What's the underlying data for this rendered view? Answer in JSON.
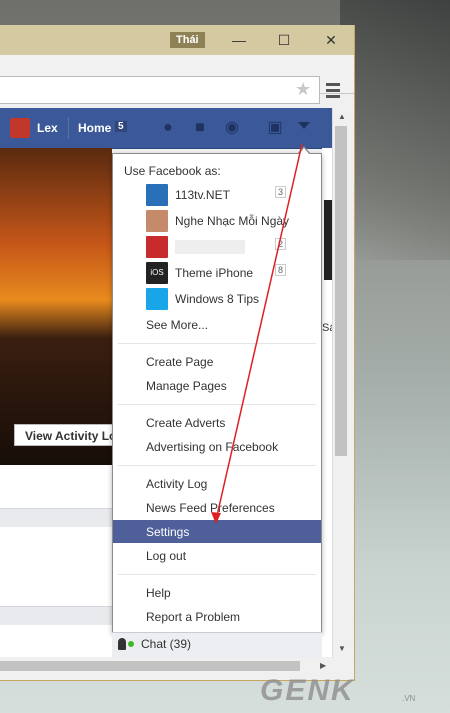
{
  "window": {
    "user_label": "Thái",
    "minimize": "—",
    "maximize": "☐",
    "close": "✕"
  },
  "fbbar": {
    "user_name": "Lex",
    "home_label": "Home",
    "home_count": "5"
  },
  "cover": {
    "view_activity_label": "View Activity Lo"
  },
  "dropdown": {
    "header": "Use Facebook as:",
    "pages": [
      {
        "name": "113tv.NET",
        "count": "3",
        "color": "#2a70b8"
      },
      {
        "name": "Nghe Nhạc Mỗi Ngày",
        "count": "",
        "color": "#c48a6a"
      },
      {
        "name": "",
        "count": "2",
        "color": "#c72b2b"
      },
      {
        "name": "Theme iPhone",
        "count": "8",
        "color": "#222222"
      },
      {
        "name": "Windows 8 Tips",
        "count": "",
        "color": "#19a6e8"
      }
    ],
    "see_more": "See More...",
    "create_page": "Create Page",
    "manage_pages": "Manage Pages",
    "create_adverts": "Create Adverts",
    "advertising": "Advertising on Facebook",
    "activity_log": "Activity Log",
    "news_feed_prefs": "News Feed Preferences",
    "settings": "Settings",
    "log_out": "Log out",
    "help": "Help",
    "report_problem": "Report a Problem"
  },
  "chat": {
    "label": "Chat (39)"
  },
  "right_edge_char": "Sá",
  "watermark": {
    "brand": "GENK",
    "suffix": ".VN"
  },
  "colors": {
    "fb_blue": "#3b5998",
    "selected": "#4e5f9a",
    "arrow": "#e02020"
  }
}
